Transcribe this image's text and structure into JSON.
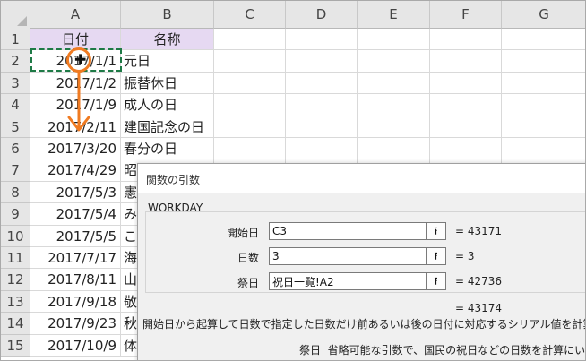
{
  "columns": [
    "A",
    "B",
    "C",
    "D",
    "E",
    "F",
    "G"
  ],
  "rows": [
    {
      "num": "1",
      "a": "日付",
      "b": "名称"
    },
    {
      "num": "2",
      "a": "2017/1/1",
      "b": "元日"
    },
    {
      "num": "3",
      "a": "2017/1/2",
      "b": "振替休日"
    },
    {
      "num": "4",
      "a": "2017/1/9",
      "b": "成人の日"
    },
    {
      "num": "5",
      "a": "2017/2/11",
      "b": "建国記念の日"
    },
    {
      "num": "6",
      "a": "2017/3/20",
      "b": "春分の日"
    },
    {
      "num": "7",
      "a": "2017/4/29",
      "b": "昭"
    },
    {
      "num": "8",
      "a": "2017/5/3",
      "b": "憲"
    },
    {
      "num": "9",
      "a": "2017/5/4",
      "b": "み"
    },
    {
      "num": "10",
      "a": "2017/5/5",
      "b": "こ"
    },
    {
      "num": "11",
      "a": "2017/7/17",
      "b": "海"
    },
    {
      "num": "12",
      "a": "2017/8/11",
      "b": "山"
    },
    {
      "num": "13",
      "a": "2017/9/18",
      "b": "敬"
    },
    {
      "num": "14",
      "a": "2017/9/23",
      "b": "秋"
    },
    {
      "num": "15",
      "a": "2017/10/9",
      "b": "体"
    }
  ],
  "annotation": {
    "arrow_color": "#f07b22",
    "marquee_color": "#1e7a46",
    "cursor_icon": "cross-cursor-icon"
  },
  "dialog": {
    "title": "関数の引数",
    "function_name": "WORKDAY",
    "args": [
      {
        "label": "開始日",
        "value": "C3",
        "result": "= 43171"
      },
      {
        "label": "日数",
        "value": "3",
        "result": "= 3"
      },
      {
        "label": "祭日",
        "value": "祝日一覧!A2",
        "result": "= 42736"
      }
    ],
    "collapse_glyph": "⭱",
    "formula_result": "= 43174",
    "description": "開始日から起算して日数で指定した日数だけ前あるいは後の日付に対応するシリアル値を計算します。",
    "arg_name": "祭日",
    "arg_description": "省略可能な引数で、国民の祝日などの日数を計算にいれない"
  }
}
